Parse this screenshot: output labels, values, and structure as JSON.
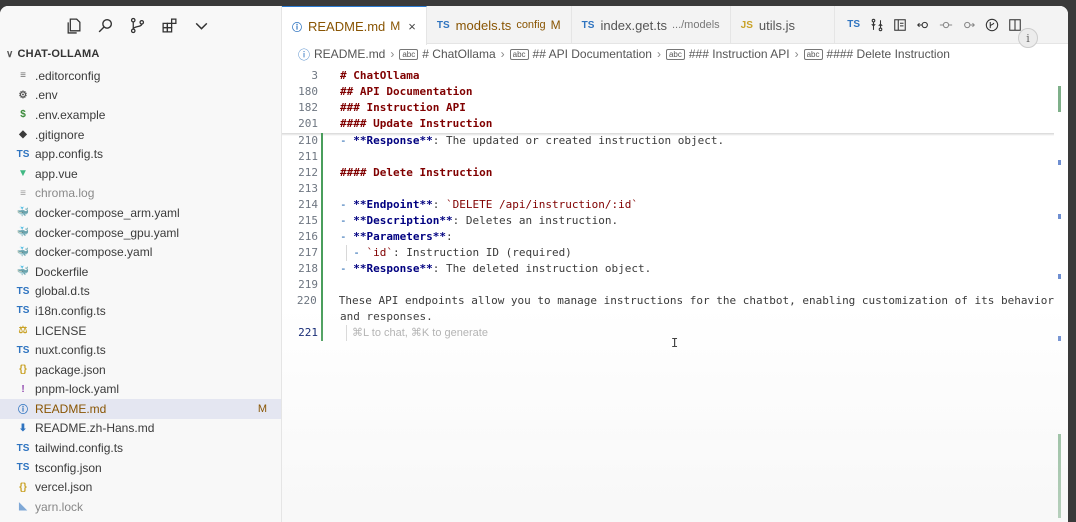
{
  "activity_bar": {
    "icons": [
      "files-icon",
      "search-icon",
      "source-control-icon",
      "extensions-icon",
      "chevron-down-icon"
    ]
  },
  "explorer": {
    "folder_name": "CHAT-OLLAMA",
    "files": [
      {
        "name": ".editorconfig",
        "icon": "≡",
        "color": "#6d6d6d"
      },
      {
        "name": ".env",
        "icon": "⚙",
        "color": "#555555"
      },
      {
        "name": ".env.example",
        "icon": "$",
        "color": "#3a8a3a"
      },
      {
        "name": ".gitignore",
        "icon": "◆",
        "color": "#3b3b3b"
      },
      {
        "name": "app.config.ts",
        "icon": "TS",
        "color": "#2f74c0"
      },
      {
        "name": "app.vue",
        "icon": "▼",
        "color": "#41b883"
      },
      {
        "name": "chroma.log",
        "icon": "≡",
        "color": "#9a9a9a",
        "dim": true
      },
      {
        "name": "docker-compose_arm.yaml",
        "icon": "🐳",
        "color": "#c0392b"
      },
      {
        "name": "docker-compose_gpu.yaml",
        "icon": "🐳",
        "color": "#c0392b"
      },
      {
        "name": "docker-compose.yaml",
        "icon": "🐳",
        "color": "#c0392b"
      },
      {
        "name": "Dockerfile",
        "icon": "🐳",
        "color": "#2f74c0"
      },
      {
        "name": "global.d.ts",
        "icon": "TS",
        "color": "#2f74c0"
      },
      {
        "name": "i18n.config.ts",
        "icon": "TS",
        "color": "#2f74c0"
      },
      {
        "name": "LICENSE",
        "icon": "⚖",
        "color": "#c9a227"
      },
      {
        "name": "nuxt.config.ts",
        "icon": "TS",
        "color": "#2f74c0"
      },
      {
        "name": "package.json",
        "icon": "{}",
        "color": "#c9a227"
      },
      {
        "name": "pnpm-lock.yaml",
        "icon": "!",
        "color": "#8e44ad"
      },
      {
        "name": "README.md",
        "icon": "ⓘ",
        "color": "#2f74c0",
        "selected": true,
        "badge": "M"
      },
      {
        "name": "README.zh-Hans.md",
        "icon": "⬇",
        "color": "#2f74c0"
      },
      {
        "name": "tailwind.config.ts",
        "icon": "TS",
        "color": "#2f74c0"
      },
      {
        "name": "tsconfig.json",
        "icon": "TS",
        "color": "#2f74c0"
      },
      {
        "name": "vercel.json",
        "icon": "{}",
        "color": "#c9a227"
      },
      {
        "name": "yarn.lock",
        "icon": "◣",
        "color": "#2f74c0",
        "cut": true
      }
    ]
  },
  "tabs": [
    {
      "label": "README.md",
      "icon": "ⓘ",
      "icon_color": "#2f74c0",
      "sub": "",
      "mod": "M",
      "active": true,
      "close": "×"
    },
    {
      "label": "models.ts",
      "icon": "TS",
      "icon_color": "#2f74c0",
      "sub": "config",
      "mod": "M",
      "active": false
    },
    {
      "label": "index.get.ts",
      "icon": "TS",
      "icon_color": "#2f74c0",
      "sub": ".../models",
      "mod": "",
      "active": false
    },
    {
      "label": "utils.js",
      "icon": "JS",
      "icon_color": "#c9a227",
      "sub": "",
      "mod": "",
      "active": false
    }
  ],
  "tab_actions": [
    "TS",
    "compare-icon",
    "split-icon",
    "go-back-icon",
    "circle-dot-icon",
    "go-forward-icon",
    "git-branch-icon",
    "split-editor-icon",
    "more-icon"
  ],
  "breadcrumb": [
    {
      "label": "README.md",
      "icon": "ⓘ"
    },
    {
      "label": "# ChatOllama",
      "icon": "abc"
    },
    {
      "label": "## API Documentation",
      "icon": "abc"
    },
    {
      "label": "### Instruction API",
      "icon": "abc"
    },
    {
      "label": "#### Delete Instruction",
      "icon": "abc"
    }
  ],
  "sticky_lines": [
    {
      "ln": "3",
      "text": "# ChatOllama"
    },
    {
      "ln": "180",
      "text": "## API Documentation"
    },
    {
      "ln": "182",
      "text": "### Instruction API"
    },
    {
      "ln": "201",
      "text": "#### Update Instruction"
    }
  ],
  "code_lines": [
    {
      "ln": "210",
      "parts": [
        {
          "t": "- ",
          "c": "kw"
        },
        {
          "t": "**Response**",
          "c": "bold"
        },
        {
          "t": ": The updated or created instruction object.",
          "c": ""
        }
      ]
    },
    {
      "ln": "211",
      "parts": []
    },
    {
      "ln": "212",
      "parts": [
        {
          "t": "#### Delete Instruction",
          "c": "hdr"
        }
      ]
    },
    {
      "ln": "213",
      "parts": []
    },
    {
      "ln": "214",
      "parts": [
        {
          "t": "- ",
          "c": "kw"
        },
        {
          "t": "**Endpoint**",
          "c": "bold"
        },
        {
          "t": ": ",
          "c": ""
        },
        {
          "t": "`DELETE /api/instruction/:id`",
          "c": "code"
        }
      ]
    },
    {
      "ln": "215",
      "parts": [
        {
          "t": "- ",
          "c": "kw"
        },
        {
          "t": "**Description**",
          "c": "bold"
        },
        {
          "t": ": Deletes an instruction.",
          "c": ""
        }
      ]
    },
    {
      "ln": "216",
      "parts": [
        {
          "t": "- ",
          "c": "kw"
        },
        {
          "t": "**Parameters**",
          "c": "bold"
        },
        {
          "t": ":",
          "c": ""
        }
      ]
    },
    {
      "ln": "217",
      "parts": [
        {
          "t": "  - ",
          "c": "kw"
        },
        {
          "t": "`id`",
          "c": "code"
        },
        {
          "t": ": Instruction ID (required)",
          "c": ""
        }
      ]
    },
    {
      "ln": "218",
      "parts": [
        {
          "t": "- ",
          "c": "kw"
        },
        {
          "t": "**Response**",
          "c": "bold"
        },
        {
          "t": ": The deleted instruction object.",
          "c": ""
        }
      ]
    },
    {
      "ln": "219",
      "parts": []
    },
    {
      "ln": "220",
      "parts": [
        {
          "t": "These API endpoints allow you to manage instructions for the chatbot, enabling customization of its behavior",
          "c": ""
        }
      ]
    },
    {
      "ln": "",
      "parts": [
        {
          "t": "and responses.",
          "c": ""
        }
      ]
    },
    {
      "ln": "221",
      "parts": [],
      "placeholder": "⌘L to chat, ⌘K to generate",
      "current": true
    }
  ],
  "info_button": "i"
}
